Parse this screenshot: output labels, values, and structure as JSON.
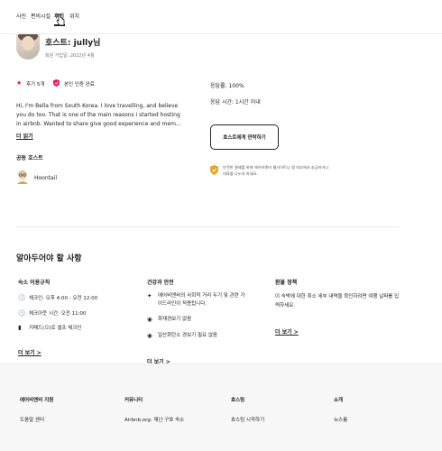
{
  "nav": {
    "tabs": [
      {
        "label": "사진"
      },
      {
        "label": "편의시설"
      },
      {
        "label": "후기"
      },
      {
        "label": "위치"
      }
    ]
  },
  "host": {
    "name": "호스트: jully님",
    "joined": "회원 가입일: 2022년 4월",
    "reviews_badge": "후기 5개",
    "verified_badge": "본인 인증 완료",
    "description": "Hi, I'm Bella from South Korea. I love travelling, and believe you do too. That is one of the main reasons i started hosting in airbnb. Wanted to share give good experience and mem...",
    "more_link": "더 읽기",
    "cohost_title": "공동 호스트",
    "cohost_name": "Hoontail",
    "response_rate": "응답률: 100%",
    "response_time": "응답 시간: 1시간 이내",
    "contact_button": "호스트에게 연락하기",
    "safety_note": "안전한 결제를 위해 에어비앤비 웹사이트나 앱 외부에서 송금하거나 대화를 나누지 마세요."
  },
  "things_to_know": {
    "title": "알아두어야 할 사항",
    "house_rules": {
      "title": "숙소 이용규칙",
      "items": [
        {
          "icon": "clock-icon",
          "text": "체크인: 오후 4:00 - 오전 12:00"
        },
        {
          "icon": "clock-icon",
          "text": "체크아웃 시간: 오전 11:00"
        },
        {
          "icon": "keypad-icon",
          "text": "키패드(으)로 셀프 체크인"
        }
      ],
      "more_link": "더 보기 >"
    },
    "health_safety": {
      "title": "건강과 안전",
      "items": [
        {
          "icon": "sparkle-icon",
          "text": "에어비앤비의 사회적 거리 두기 및 관련 가이드라인이 적용됩니다."
        },
        {
          "icon": "smoke-alarm-icon",
          "text": "화재경보기 없음"
        },
        {
          "icon": "co-alarm-icon",
          "text": "일산화탄소 경보기 필요 없음"
        }
      ],
      "more_link": "더 보기 >"
    },
    "refund_policy": {
      "title": "환불 정책",
      "text": "이 숙박에 대한 취소 세부 내역을 확인하려면 여행 날짜를 입력하세요.",
      "more_link": "더 보기 >"
    }
  },
  "footer": {
    "columns": [
      {
        "title": "에어비앤비 지원",
        "first_link": "도움말 센터"
      },
      {
        "title": "커뮤니티",
        "first_link": "Airbnb.org: 재난 구호 숙소"
      },
      {
        "title": "호스팅",
        "first_link": "호스팅 시작하기"
      },
      {
        "title": "소개",
        "first_link": "뉴스룸"
      }
    ]
  },
  "colors": {
    "star": "#e31c5f",
    "shield": "#e31c5f",
    "divider": "#ebebeb",
    "footer_bg": "#f7f7f7",
    "text": "#222222",
    "muted": "#717171"
  }
}
